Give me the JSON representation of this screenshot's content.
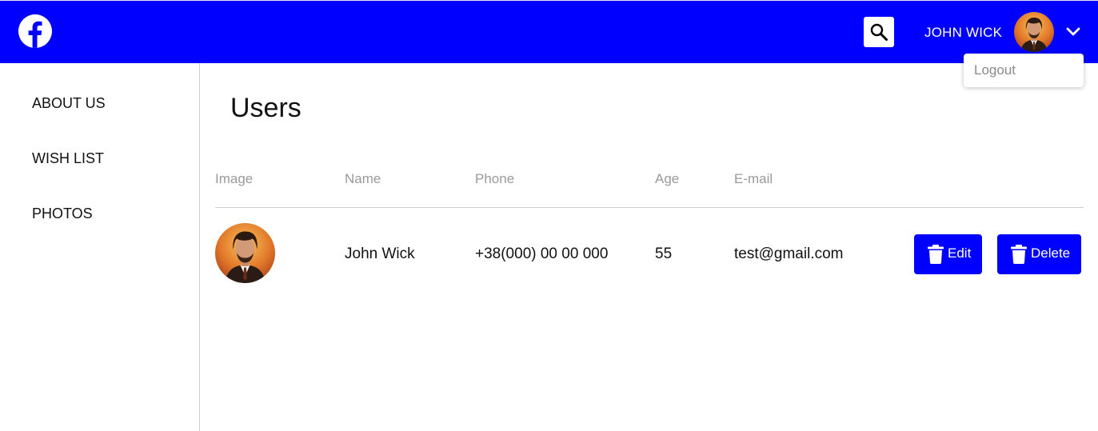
{
  "header": {
    "logo_icon": "facebook-icon",
    "search_icon": "search-icon",
    "user_name": "JOHN WICK",
    "menu_icon": "chevron-down-icon",
    "brand_color": "#0000ff"
  },
  "dropdown": {
    "items": [
      {
        "label": "Logout"
      }
    ]
  },
  "sidebar": {
    "items": [
      {
        "label": "ABOUT US"
      },
      {
        "label": "WISH LIST"
      },
      {
        "label": "PHOTOS"
      }
    ]
  },
  "main": {
    "title": "Users",
    "table": {
      "columns": [
        "Image",
        "Name",
        "Phone",
        "Age",
        "E-mail"
      ],
      "rows": [
        {
          "name": "John Wick",
          "phone": "+38(000) 00 00 000",
          "age": "55",
          "email": "test@gmail.com",
          "edit_label": "Edit",
          "delete_label": "Delete",
          "action_icon": "trash-icon"
        }
      ]
    }
  }
}
